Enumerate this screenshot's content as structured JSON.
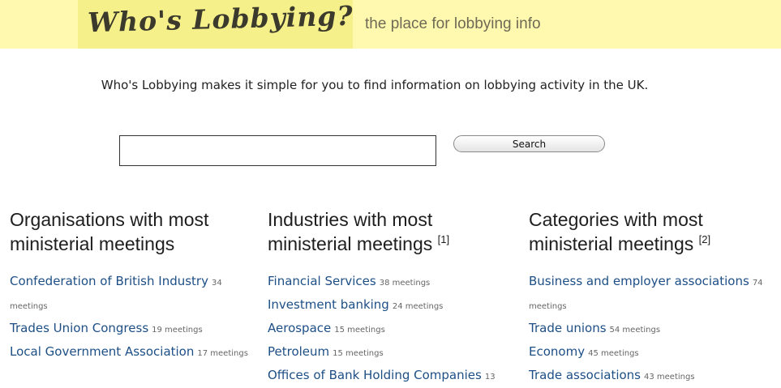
{
  "header": {
    "logo_text": "Who's Lobbying?",
    "tagline": "the place for lobbying info"
  },
  "intro": "Who's Lobbying makes it simple for you to find information on lobbying activity in the UK.",
  "search": {
    "value": "",
    "button_label": "Search"
  },
  "columns": [
    {
      "title": "Organisations with most ministerial meetings",
      "footnote": "",
      "items": [
        {
          "name": "Confederation of British Industry",
          "count": "34 meetings"
        },
        {
          "name": "Trades Union Congress",
          "count": "19 meetings"
        },
        {
          "name": "Local Government Association",
          "count": "17 meetings"
        }
      ]
    },
    {
      "title": "Industries with most ministerial meetings",
      "footnote": "[1]",
      "items": [
        {
          "name": "Financial Services",
          "count": "38 meetings"
        },
        {
          "name": "Investment banking",
          "count": "24 meetings"
        },
        {
          "name": "Aerospace",
          "count": "15 meetings"
        },
        {
          "name": "Petroleum",
          "count": "15 meetings"
        },
        {
          "name": "Offices of Bank Holding Companies",
          "count": "13"
        }
      ]
    },
    {
      "title": "Categories with most ministerial meetings",
      "footnote": "[2]",
      "items": [
        {
          "name": "Business and employer associations",
          "count": "74 meetings"
        },
        {
          "name": "Trade unions",
          "count": "54 meetings"
        },
        {
          "name": "Economy",
          "count": "45 meetings"
        },
        {
          "name": "Trade associations",
          "count": "43 meetings"
        }
      ]
    }
  ]
}
